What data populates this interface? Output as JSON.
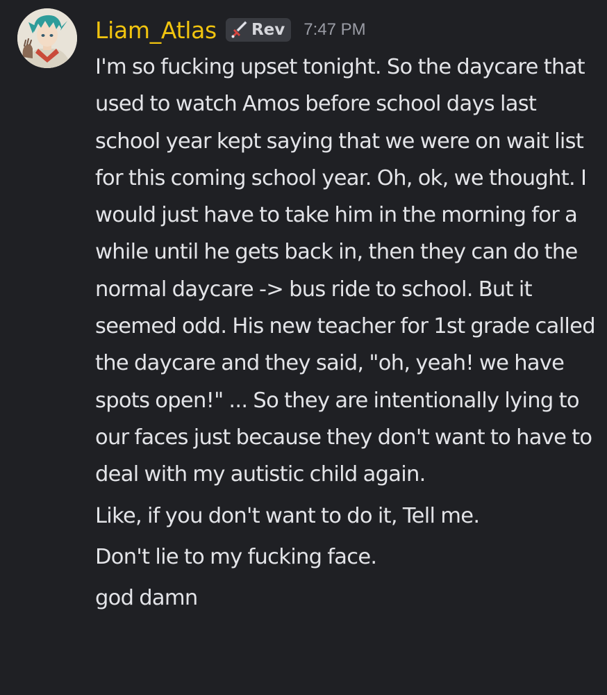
{
  "message": {
    "author": "Liam_Atlas",
    "author_color": "#f1c40f",
    "tag": {
      "icon": "sword-icon",
      "label": "Rev"
    },
    "timestamp": "7:47 PM",
    "paragraphs": [
      "I'm so fucking upset tonight. So the daycare that used to watch Amos before school days last school year kept saying that we were on wait list for this coming school year. Oh, ok, we thought. I would just have to take him in the morning for a while until he gets back in, then they can do the normal daycare -> bus ride to school. But it seemed odd. His new teacher for 1st grade called the daycare and they said, \"oh, yeah! we have spots open!\" ... So they are intentionally lying to our faces just because they don't want to have to deal with my autistic child again.",
      "Like, if you don't want to do it, Tell me.",
      "Don't lie to my fucking face.",
      "god damn"
    ]
  },
  "colors": {
    "background": "#1f2024",
    "text": "#e3e4e8",
    "timestamp": "#9a9ca5",
    "tag_background": "#393b41"
  }
}
